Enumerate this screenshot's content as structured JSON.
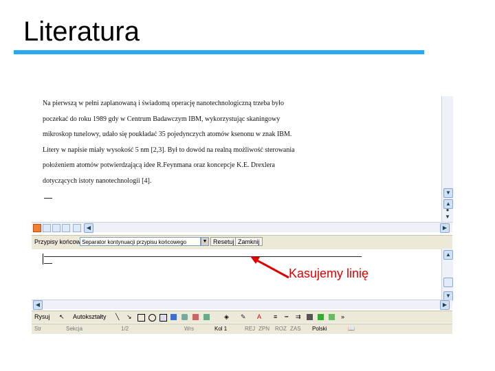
{
  "slide": {
    "title": "Literatura",
    "accent_color": "#29aaf0"
  },
  "document": {
    "lines": [
      "Na pierwszą w pełni zaplanowaną i świadomą operację nanotechnologiczną trzeba było",
      "poczekać do roku 1989 gdy w Centrum Badawczym IBM, wykorzystując skaningowy",
      "mikroskop tunelowy, udało się poukładać 35 pojedynczych atomów ksenonu w znak IBM.",
      "Litery w napisie miały wysokość 5 nm [2,3]. Był to dowód na realną możliwość sterowania",
      "położeniem atomów potwierdzającą idee R.Feynmana oraz koncepcje K.E. Drexlera",
      "dotyczących istoty nanotechnologii [4]."
    ]
  },
  "footnote_toolbar": {
    "label": "Przypisy końcowe",
    "select_value": "Separator kontynuacji przypisu końcowego",
    "reset_label": "Resetuj",
    "close_label": "Zamknij"
  },
  "drawing_toolbar": {
    "draw_label": "Rysuj",
    "autoshapes_label": "Autokształty"
  },
  "status_bar": {
    "page": "Str",
    "section": "Sekcja",
    "position": "1/2",
    "line": "Wrs",
    "column": "Kol 1",
    "rec": "REJ",
    "trk": "ZPN",
    "ext": "ROZ",
    "ovr": "ZAS",
    "language": "Polski"
  },
  "annotation": {
    "text": "Kasujemy linię",
    "color": "#e00000"
  }
}
